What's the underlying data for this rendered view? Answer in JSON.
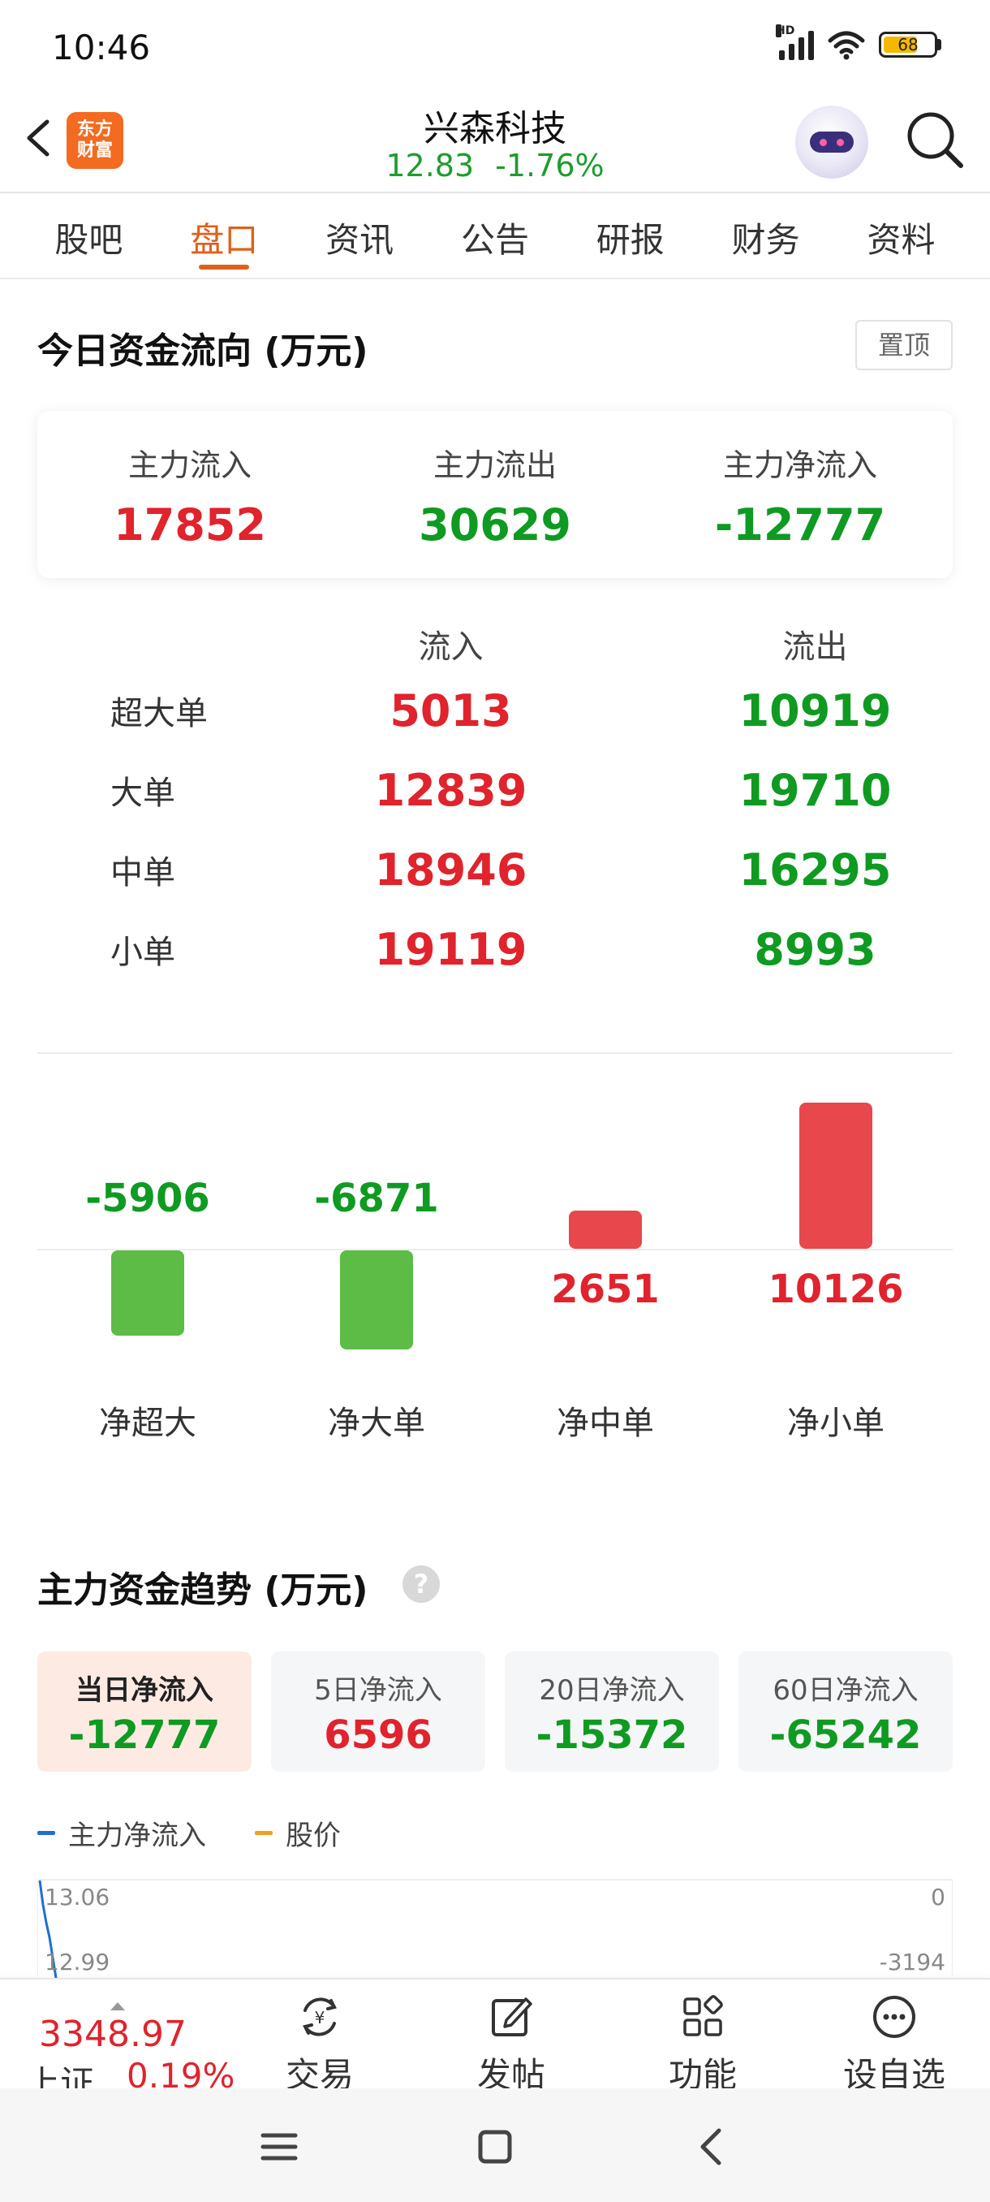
{
  "status_bar": {
    "time": "10:46",
    "battery": "68",
    "network_label": "HD"
  },
  "header": {
    "app_logo": "东方\n财富",
    "stock_name": "兴森科技",
    "price": "12.83",
    "change_pct": "-1.76%"
  },
  "tabs": [
    {
      "label": "股吧",
      "active": false
    },
    {
      "label": "盘口",
      "active": true
    },
    {
      "label": "资讯",
      "active": false
    },
    {
      "label": "公告",
      "active": false
    },
    {
      "label": "研报",
      "active": false
    },
    {
      "label": "财务",
      "active": false
    },
    {
      "label": "资料",
      "active": false
    }
  ],
  "fund_flow": {
    "title": "今日资金流向 (万元)",
    "pin_label": "置顶",
    "summary": [
      {
        "label": "主力流入",
        "value": "17852",
        "color": "#e0232c"
      },
      {
        "label": "主力流出",
        "value": "30629",
        "color": "#0f9a22"
      },
      {
        "label": "主力净流入",
        "value": "-12777",
        "color": "#0f9a22"
      }
    ],
    "columns": {
      "inflow": "流入",
      "outflow": "流出"
    },
    "rows": [
      {
        "name": "超大单",
        "inflow": "5013",
        "outflow": "10919"
      },
      {
        "name": "大单",
        "inflow": "12839",
        "outflow": "19710"
      },
      {
        "name": "中单",
        "inflow": "18946",
        "outflow": "16295"
      },
      {
        "name": "小单",
        "inflow": "19119",
        "outflow": "8993"
      }
    ]
  },
  "chart_data": {
    "type": "bar",
    "categories": [
      "净超大",
      "净大单",
      "净中单",
      "净小单"
    ],
    "values": [
      -5906,
      -6871,
      2651,
      10126
    ],
    "value_labels": [
      "-5906",
      "-6871",
      "2651",
      "10126"
    ],
    "title": "",
    "xlabel": "",
    "ylabel": "",
    "positive_color": "#e8474c",
    "negative_color": "#5cbc45"
  },
  "trend": {
    "title": "主力资金趋势 (万元)",
    "help_icon": "question-icon",
    "periods": [
      {
        "label": "当日净流入",
        "value": "-12777",
        "active": true,
        "color": "#0f9a22"
      },
      {
        "label": "5日净流入",
        "value": "6596",
        "active": false,
        "color": "#e0232c"
      },
      {
        "label": "20日净流入",
        "value": "-15372",
        "active": false,
        "color": "#0f9a22"
      },
      {
        "label": "60日净流入",
        "value": "-65242",
        "active": false,
        "color": "#0f9a22"
      }
    ],
    "legend": [
      {
        "label": "主力净流入",
        "color": "#1f6fd1"
      },
      {
        "label": "股价",
        "color": "#f0a020"
      }
    ],
    "left_ticks": [
      "13.06",
      "12.99"
    ],
    "right_ticks": [
      "0",
      "-3194"
    ]
  },
  "bottom_bar": {
    "index_price": "3348.97",
    "index_name": "上证",
    "index_change": "0.19%",
    "nav": [
      {
        "label": "交易",
        "icon": "trade-icon"
      },
      {
        "label": "发帖",
        "icon": "post-icon"
      },
      {
        "label": "功能",
        "icon": "function-icon"
      },
      {
        "label": "设自选",
        "icon": "more-icon"
      }
    ]
  }
}
